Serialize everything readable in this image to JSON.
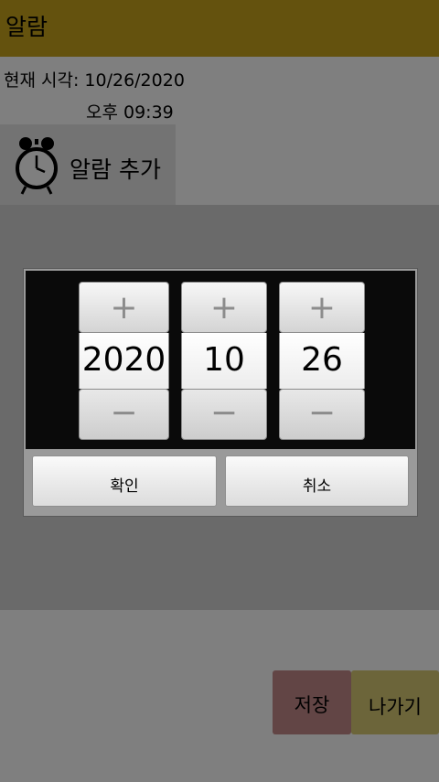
{
  "app": {
    "title": "알람",
    "current_time_label": "현재 시각: 10/26/2020",
    "current_time_value": "오후 09:39",
    "add_alarm_label": "알람 추가",
    "save_label": "저장",
    "exit_label": "나가기"
  },
  "dialog": {
    "year": "2020",
    "month": "10",
    "day": "26",
    "plus_symbol": "+",
    "minus_symbol": "−",
    "ok_label": "확인",
    "cancel_label": "취소"
  },
  "colors": {
    "title_bar": "#c8a51c",
    "save_button": "#c58a8a",
    "exit_button": "#d9ca75"
  },
  "icons": {
    "add_alarm": "alarm-clock-icon"
  }
}
